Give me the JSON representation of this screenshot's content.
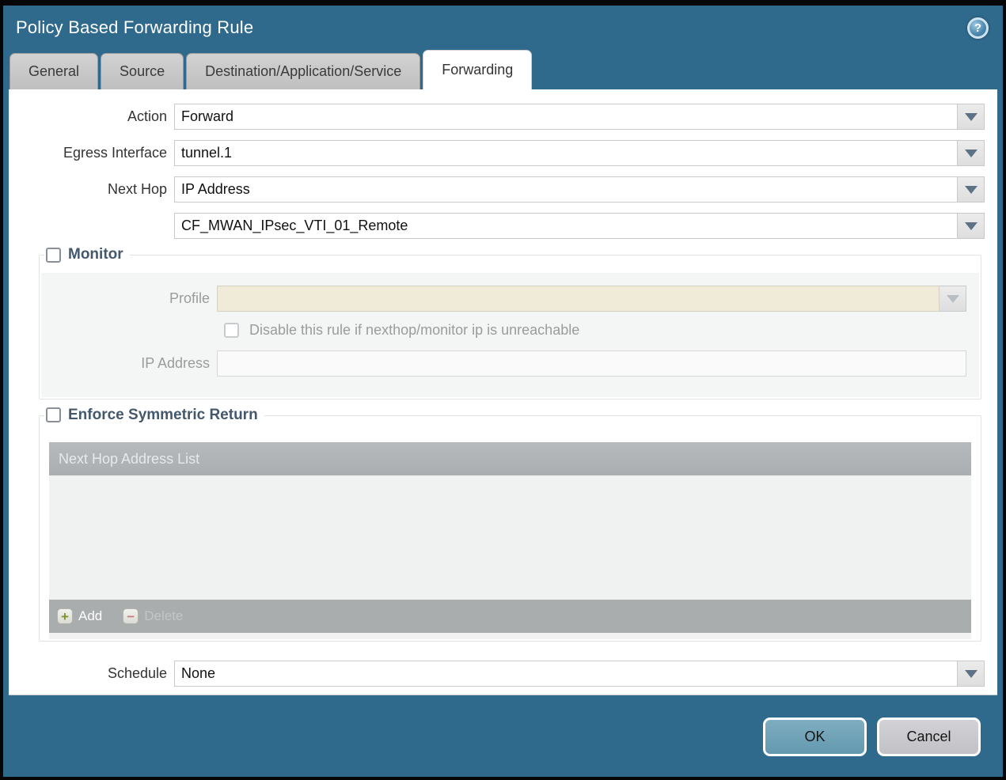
{
  "window": {
    "title": "Policy Based Forwarding Rule",
    "help_icon_glyph": "?"
  },
  "tabs": [
    {
      "label": "General",
      "active": false
    },
    {
      "label": "Source",
      "active": false
    },
    {
      "label": "Destination/Application/Service",
      "active": false
    },
    {
      "label": "Forwarding",
      "active": true
    }
  ],
  "form": {
    "action": {
      "label": "Action",
      "value": "Forward"
    },
    "egress_interface": {
      "label": "Egress Interface",
      "value": "tunnel.1"
    },
    "next_hop": {
      "label": "Next Hop",
      "value": "IP Address"
    },
    "next_hop_address": {
      "value": "CF_MWAN_IPsec_VTI_01_Remote"
    },
    "schedule": {
      "label": "Schedule",
      "value": "None"
    }
  },
  "monitor": {
    "legend": "Monitor",
    "checked": false,
    "profile": {
      "label": "Profile",
      "value": ""
    },
    "disable_rule": {
      "label": "Disable this rule if nexthop/monitor ip is unreachable",
      "checked": false
    },
    "ip_address": {
      "label": "IP Address",
      "value": ""
    }
  },
  "symmetric_return": {
    "legend": "Enforce Symmetric Return",
    "checked": false,
    "table": {
      "header": "Next Hop Address List",
      "rows": []
    },
    "add_label": "Add",
    "delete_label": "Delete",
    "add_icon_glyph": "+",
    "delete_icon_glyph": "−"
  },
  "footer": {
    "ok_label": "OK",
    "cancel_label": "Cancel"
  },
  "colors": {
    "titlebar": "#2f698c",
    "active_tab": "#ffffff",
    "inactive_tab": "#c6c6c6",
    "disabled_profile_field": "#f0ead9",
    "table_header": "#b0b4b7",
    "ok_button": "#6ea3b9",
    "cancel_button": "#c9c9cd"
  }
}
